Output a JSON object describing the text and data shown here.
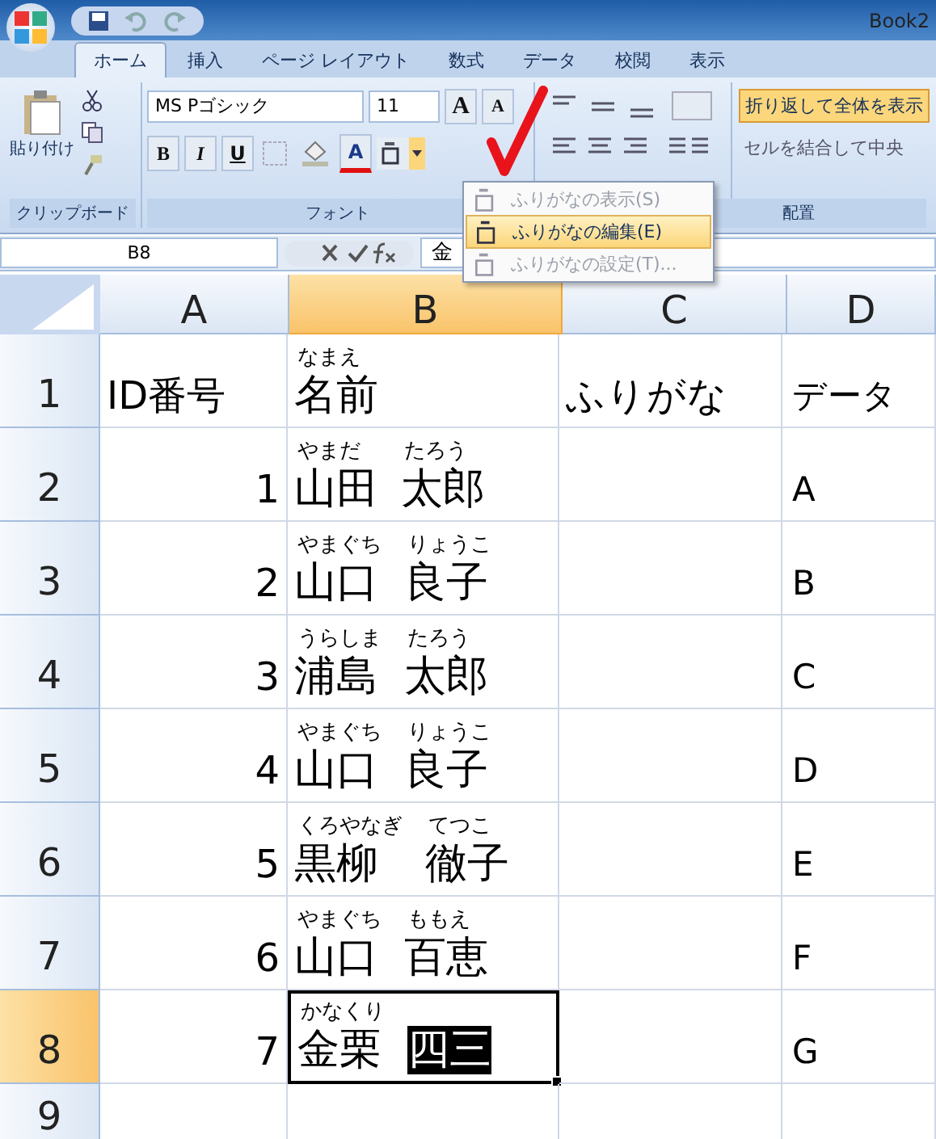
{
  "window": {
    "title": "Book2"
  },
  "tabs": [
    {
      "label": "ホーム",
      "selected": true
    },
    {
      "label": "挿入",
      "selected": false
    },
    {
      "label": "ページ レイアウト",
      "selected": false
    },
    {
      "label": "数式",
      "selected": false
    },
    {
      "label": "データ",
      "selected": false
    },
    {
      "label": "校閲",
      "selected": false
    },
    {
      "label": "表示",
      "selected": false
    }
  ],
  "ribbon": {
    "clipboard": {
      "paste": "貼り付け",
      "label": "クリップボード"
    },
    "font": {
      "name": "MS Pゴシック",
      "size": "11",
      "grow": "A",
      "shrink": "A",
      "bold": "B",
      "italic": "I",
      "underline": "U",
      "color_button": "A",
      "label": "フォント"
    },
    "alignment": {
      "wrap": "折り返して全体を表示",
      "merge": "セルを結合して中央",
      "label": "配置"
    }
  },
  "menu": [
    {
      "label": "ふりがなの表示(S)",
      "disabled": true,
      "selected": false
    },
    {
      "label": "ふりがなの編集(E)",
      "disabled": false,
      "selected": true
    },
    {
      "label": "ふりがなの設定(T)...",
      "disabled": true,
      "selected": false
    }
  ],
  "formula_bar": {
    "name_box": "B8",
    "content": "金"
  },
  "columns": [
    {
      "label": "A",
      "selected": false
    },
    {
      "label": "B",
      "selected": true
    },
    {
      "label": "C",
      "selected": false
    },
    {
      "label": "D",
      "selected": false
    }
  ],
  "rows": [
    {
      "number": "1",
      "selected": false,
      "a": {
        "text": "ID番号",
        "kind": "text"
      },
      "b": [
        {
          "ruby": "なまえ",
          "text": "名前",
          "highlighted": false
        }
      ],
      "c": "ふりがな",
      "d": "データ"
    },
    {
      "number": "2",
      "selected": false,
      "a": {
        "text": "1",
        "kind": "number"
      },
      "b": [
        {
          "ruby": "やまだ",
          "text": "山田",
          "highlighted": false
        },
        {
          "ruby": "たろう",
          "text": "太郎",
          "highlighted": false
        }
      ],
      "d": "A"
    },
    {
      "number": "3",
      "selected": false,
      "a": {
        "text": "2",
        "kind": "number"
      },
      "b": [
        {
          "ruby": "やまぐち",
          "text": "山口",
          "highlighted": false
        },
        {
          "ruby": "りょうこ",
          "text": "良子",
          "highlighted": false
        }
      ],
      "d": "B"
    },
    {
      "number": "4",
      "selected": false,
      "a": {
        "text": "3",
        "kind": "number"
      },
      "b": [
        {
          "ruby": "うらしま",
          "text": "浦島",
          "highlighted": false
        },
        {
          "ruby": "たろう",
          "text": "太郎",
          "highlighted": false
        }
      ],
      "d": "C"
    },
    {
      "number": "5",
      "selected": false,
      "a": {
        "text": "4",
        "kind": "number"
      },
      "b": [
        {
          "ruby": "やまぐち",
          "text": "山口",
          "highlighted": false
        },
        {
          "ruby": "りょうこ",
          "text": "良子",
          "highlighted": false
        }
      ],
      "d": "D"
    },
    {
      "number": "6",
      "selected": false,
      "a": {
        "text": "5",
        "kind": "number"
      },
      "b": [
        {
          "ruby": "くろやなぎ",
          "text": "黒柳",
          "highlighted": false
        },
        {
          "ruby": "てつこ",
          "text": "徹子",
          "highlighted": false
        }
      ],
      "d": "E"
    },
    {
      "number": "7",
      "selected": false,
      "a": {
        "text": "6",
        "kind": "number"
      },
      "b": [
        {
          "ruby": "やまぐち",
          "text": "山口",
          "highlighted": false
        },
        {
          "ruby": "ももえ",
          "text": "百恵",
          "highlighted": false
        }
      ],
      "d": "F"
    },
    {
      "number": "8",
      "selected": true,
      "a": {
        "text": "7",
        "kind": "number"
      },
      "b": [
        {
          "ruby": "かなくり",
          "text": "金栗",
          "highlighted": false
        },
        {
          "text": "四三",
          "highlighted": true
        }
      ],
      "d": "G"
    },
    {
      "number": "9",
      "selected": false
    }
  ]
}
